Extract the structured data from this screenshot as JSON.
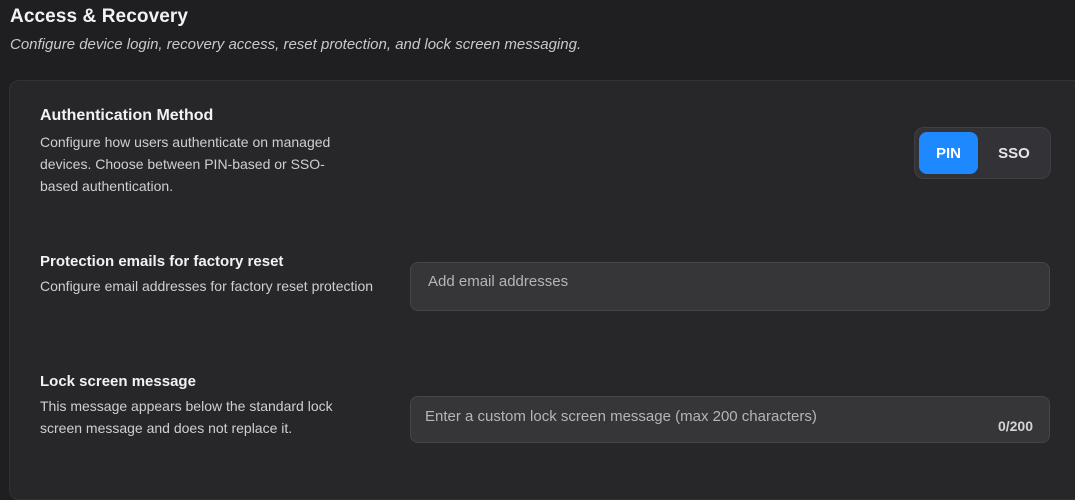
{
  "header": {
    "title": "Access & Recovery",
    "subtitle": "Configure device login, recovery access, reset protection, and lock screen messaging."
  },
  "auth_method": {
    "title": "Authentication Method",
    "description": "Configure how users authenticate on managed devices. Choose between PIN-based or SSO-based authentication.",
    "options": [
      "PIN",
      "SSO"
    ],
    "selected": "PIN"
  },
  "protection_emails": {
    "title": "Protection emails for factory reset",
    "description": "Configure email addresses for factory reset protection",
    "placeholder": "Add email addresses"
  },
  "lock_screen": {
    "title": "Lock screen message",
    "description": "This message appears below the standard lock screen message and does not replace it.",
    "placeholder": "Enter a custom lock screen message (max 200 characters)",
    "counter": "0/200"
  },
  "colors": {
    "background": "#1f1f21",
    "card": "#27272a",
    "accent": "#1e88ff"
  }
}
